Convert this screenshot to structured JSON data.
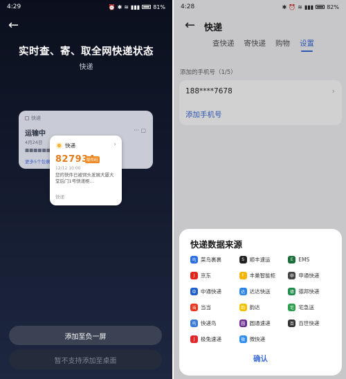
{
  "left": {
    "status": {
      "time": "4:29",
      "battery": "81%",
      "level": 0.81
    },
    "title": "实时查、寄、取全网快递状态",
    "subtitle": "快递",
    "bg_card": {
      "app": "快递",
      "status": "运输中",
      "date": "4月24日",
      "more": "更多5个包裹",
      "icon_dots": "··· ▢"
    },
    "fg_card": {
      "app": "快递",
      "code": "827934",
      "badge": "取件码",
      "datetime": "12/12 10:00",
      "message": "您的快件已被饲头发展大厦大堂后门1号快递柜…",
      "footer": "快递"
    },
    "btn_add": "添加至负一屏",
    "btn_desktop": "暂不支持添加至桌面"
  },
  "right": {
    "status": {
      "time": "4:28",
      "battery": "82%",
      "level": 0.82
    },
    "title": "快递",
    "tabs": [
      "查快递",
      "寄快递",
      "购物",
      "设置"
    ],
    "active_tab": 3,
    "section_label": "添加的手机号（1/5）",
    "phone": "188****7678",
    "add_phone": "添加手机号",
    "sheet": {
      "title": "快递数据来源",
      "sources": [
        {
          "name": "菜鸟裹裹",
          "icon": "cainiao-icon",
          "color": "#2b6fe0",
          "glyph": "鸟"
        },
        {
          "name": "顺丰速运",
          "icon": "sf-icon",
          "color": "#222222",
          "glyph": "S"
        },
        {
          "name": "EMS",
          "icon": "ems-icon",
          "color": "#1a6e3a",
          "glyph": "E"
        },
        {
          "name": "京东",
          "icon": "jd-icon",
          "color": "#e1251b",
          "glyph": "J"
        },
        {
          "name": "丰巢智能柜",
          "icon": "fengchao-icon",
          "color": "#f5b400",
          "glyph": "F"
        },
        {
          "name": "申通快递",
          "icon": "sto-icon",
          "color": "#444444",
          "glyph": "申"
        },
        {
          "name": "中通快递",
          "icon": "zto-icon",
          "color": "#1f5fc9",
          "glyph": "中"
        },
        {
          "name": "达达快送",
          "icon": "dada-icon",
          "color": "#2a84e8",
          "glyph": "达"
        },
        {
          "name": "德邦快递",
          "icon": "deppon-icon",
          "color": "#1f8c4a",
          "glyph": "德"
        },
        {
          "name": "当当",
          "icon": "dangdang-icon",
          "color": "#e8381f",
          "glyph": "当"
        },
        {
          "name": "韵达",
          "icon": "yunda-icon",
          "color": "#f2c200",
          "glyph": "韵"
        },
        {
          "name": "宅急送",
          "icon": "zjs-icon",
          "color": "#2a9d4a",
          "glyph": "宅"
        },
        {
          "name": "快递鸟",
          "icon": "kdniao-icon",
          "color": "#3a7bd5",
          "glyph": "鸟"
        },
        {
          "name": "圆通速递",
          "icon": "yto-icon",
          "color": "#6a2c91",
          "glyph": "圆"
        },
        {
          "name": "百世快递",
          "icon": "best-icon",
          "color": "#333333",
          "glyph": "百"
        },
        {
          "name": "极兔速递",
          "icon": "jt-icon",
          "color": "#e0252b",
          "glyph": "J"
        },
        {
          "name": "微快递",
          "icon": "weikd-icon",
          "color": "#2a8cf0",
          "glyph": "微"
        }
      ],
      "confirm": "确认"
    }
  }
}
